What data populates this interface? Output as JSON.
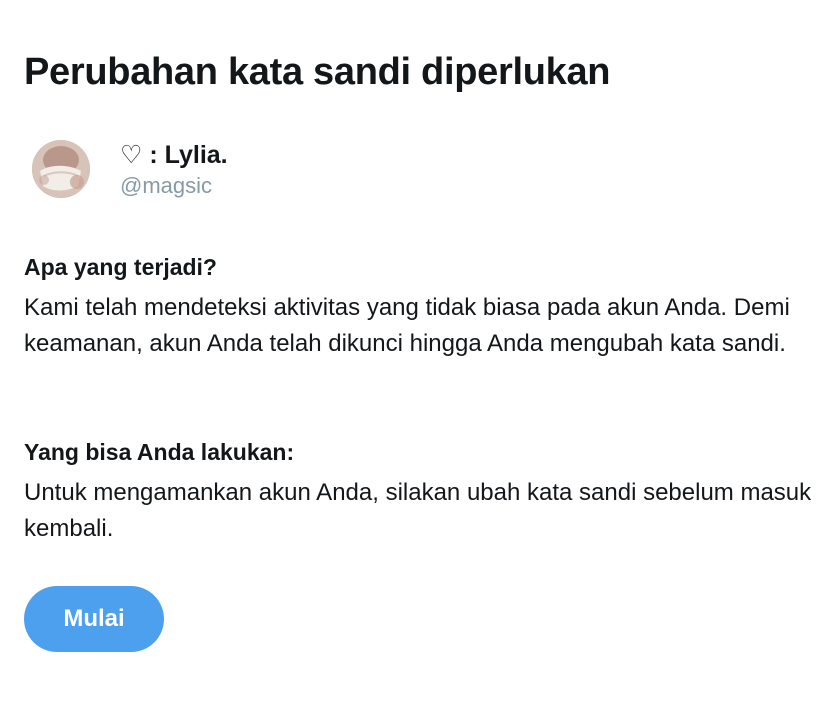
{
  "header": {
    "title": "Perubahan kata sandi diperlukan"
  },
  "account": {
    "display_name": "♡ : Lylia.",
    "handle": "@magsic",
    "avatar": "profile-photo"
  },
  "what_happened": {
    "heading": "Apa yang terjadi?",
    "body": "Kami telah mendeteksi aktivitas yang tidak biasa pada akun Anda. Demi keamanan, akun Anda telah dikunci hingga Anda mengubah kata sandi."
  },
  "what_you_can_do": {
    "heading": "Yang bisa Anda lakukan:",
    "body": "Untuk mengamankan akun Anda, silakan ubah kata sandi sebelum masuk kembali."
  },
  "actions": {
    "start_label": "Mulai",
    "start_color": "#4da0ed"
  },
  "colors": {
    "text": "#14171a",
    "secondary": "#8899a6",
    "background": "#ffffff"
  }
}
